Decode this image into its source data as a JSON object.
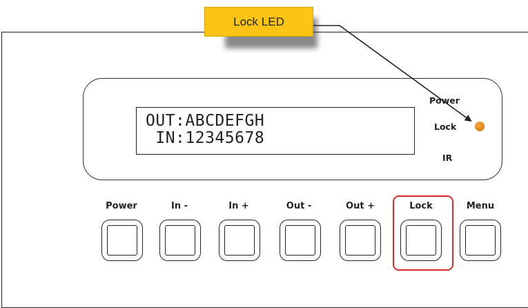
{
  "callout": {
    "label": "Lock LED",
    "color": "#fcc515"
  },
  "display": {
    "line1": "OUT:ABCDEFGH",
    "line2": " IN:12345678"
  },
  "indicators": {
    "power": "Power",
    "lock": "Lock",
    "ir": "IR",
    "lock_led_color": "#e28a1c"
  },
  "buttons": [
    {
      "label": "Power"
    },
    {
      "label": "In -"
    },
    {
      "label": "In +"
    },
    {
      "label": "Out -"
    },
    {
      "label": "Out +"
    },
    {
      "label": "Lock"
    },
    {
      "label": "Menu"
    }
  ],
  "highlight": {
    "target": "Lock",
    "color": "#d42a2a"
  }
}
